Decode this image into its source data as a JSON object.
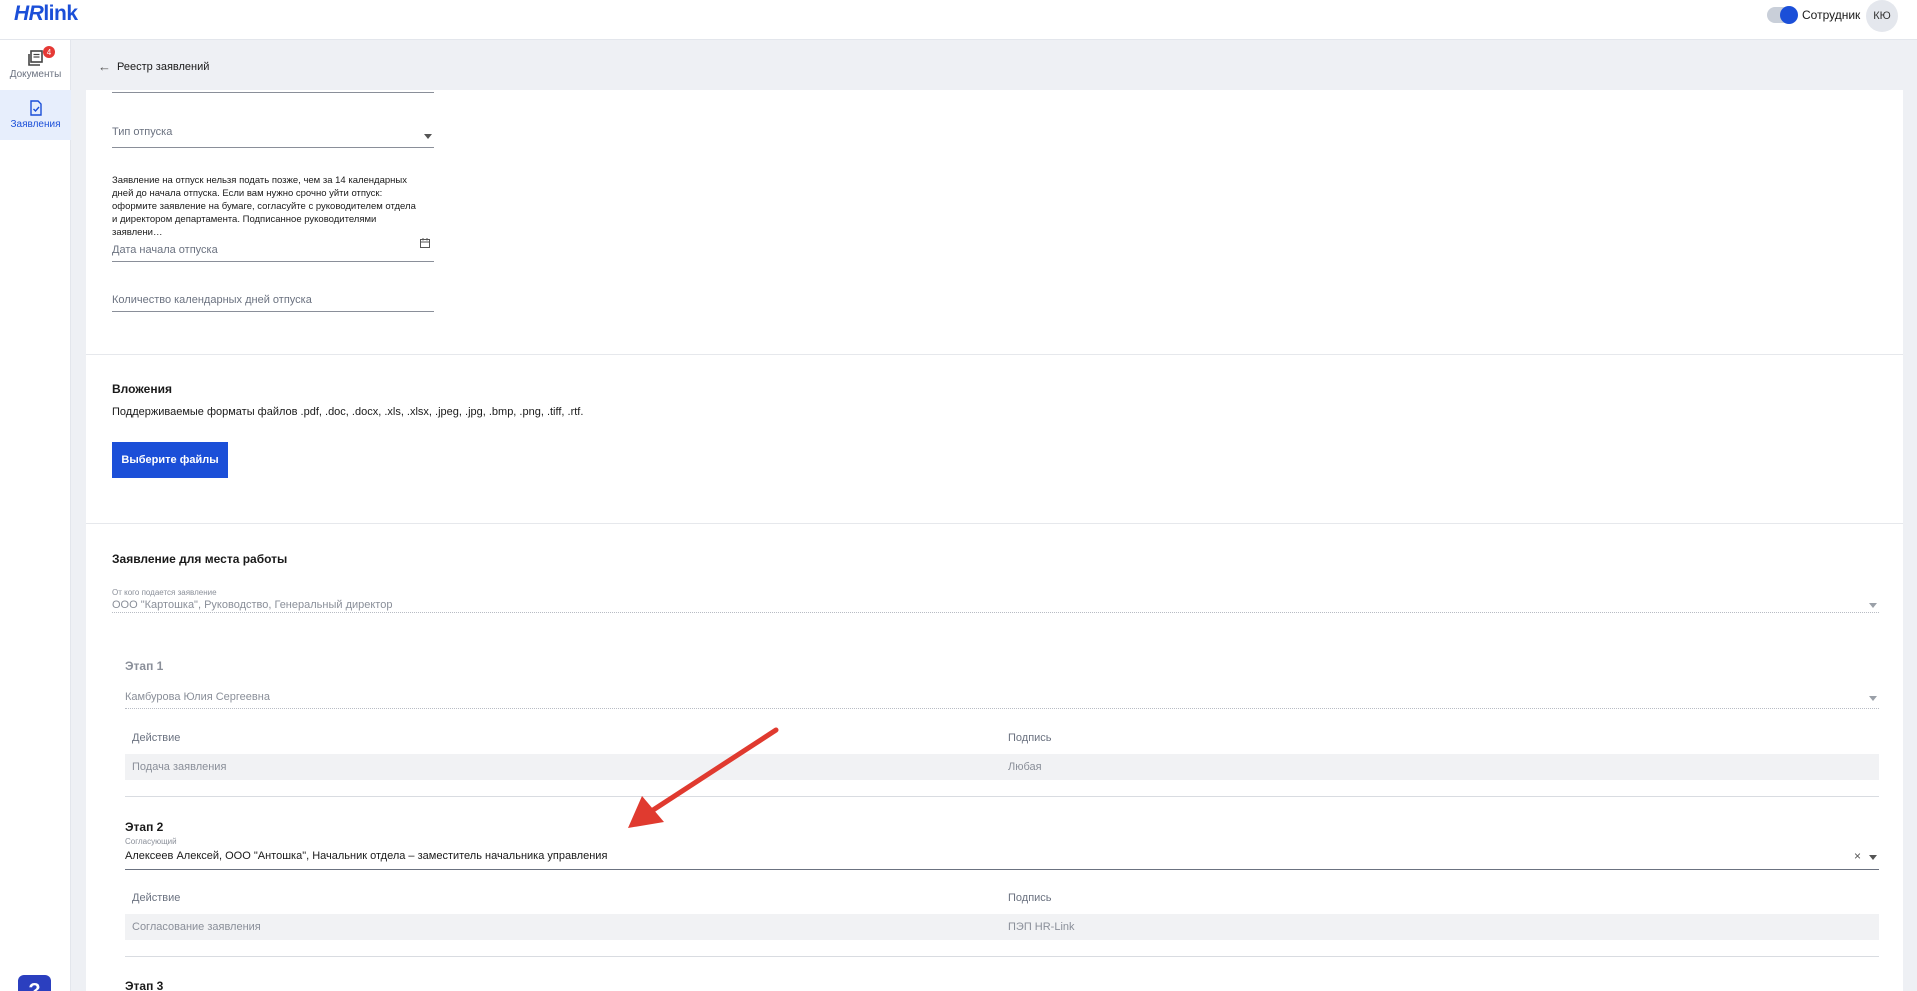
{
  "header": {
    "logo_hr": "HR",
    "logo_link": "link",
    "role_label": "Сотрудник",
    "avatar_initials": "КЮ"
  },
  "sidebar": {
    "items": [
      {
        "label": "Документы",
        "badge": "4",
        "icon": "documents-icon"
      },
      {
        "label": "Заявления",
        "icon": "application-icon",
        "active": true
      }
    ],
    "help_label": "?"
  },
  "back_link": "Реестр заявлений",
  "form": {
    "vacation_type_label": "Тип отпуска",
    "notice": "Заявление на отпуск нельзя подать позже, чем за 14 календарных дней до начала отпуска. Если вам нужно срочно уйти отпуск: оформите заявление на бумаге, согласуйте с руководителем отдела и директором департамента. Подписанное руководителями заявлени…",
    "start_date_label": "Дата начала отпуска",
    "days_count_label": "Количество календарных дней отпуска"
  },
  "attachments": {
    "title": "Вложения",
    "formats": "Поддерживаемые форматы файлов .pdf, .doc, .docx, .xls, .xlsx, .jpeg, .jpg, .bmp, .png, .tiff, .rtf.",
    "button": "Выберите файлы"
  },
  "workplace": {
    "title": "Заявление для места работы",
    "from_label": "От кого подается заявление",
    "from_value": "ООО \"Картошка\", Руководство, Генеральный директор",
    "table_headers": {
      "action": "Действие",
      "signature": "Подпись"
    },
    "stages": [
      {
        "title": "Этап 1",
        "person": "Камбурова Юлия Сергеевна",
        "action": "Подача заявления",
        "signature": "Любая"
      },
      {
        "title": "Этап 2",
        "approver_label": "Согласующий",
        "person": "Алексеев Алексей, ООО \"Антошка\", Начальник отдела – заместитель начальника управления",
        "action": "Согласование заявления",
        "signature": "ПЭП HR-Link"
      },
      {
        "title": "Этап 3"
      }
    ]
  },
  "colors": {
    "accent": "#1b4fd8",
    "badge": "#e53935",
    "annotation_arrow": "#e03a2f"
  }
}
